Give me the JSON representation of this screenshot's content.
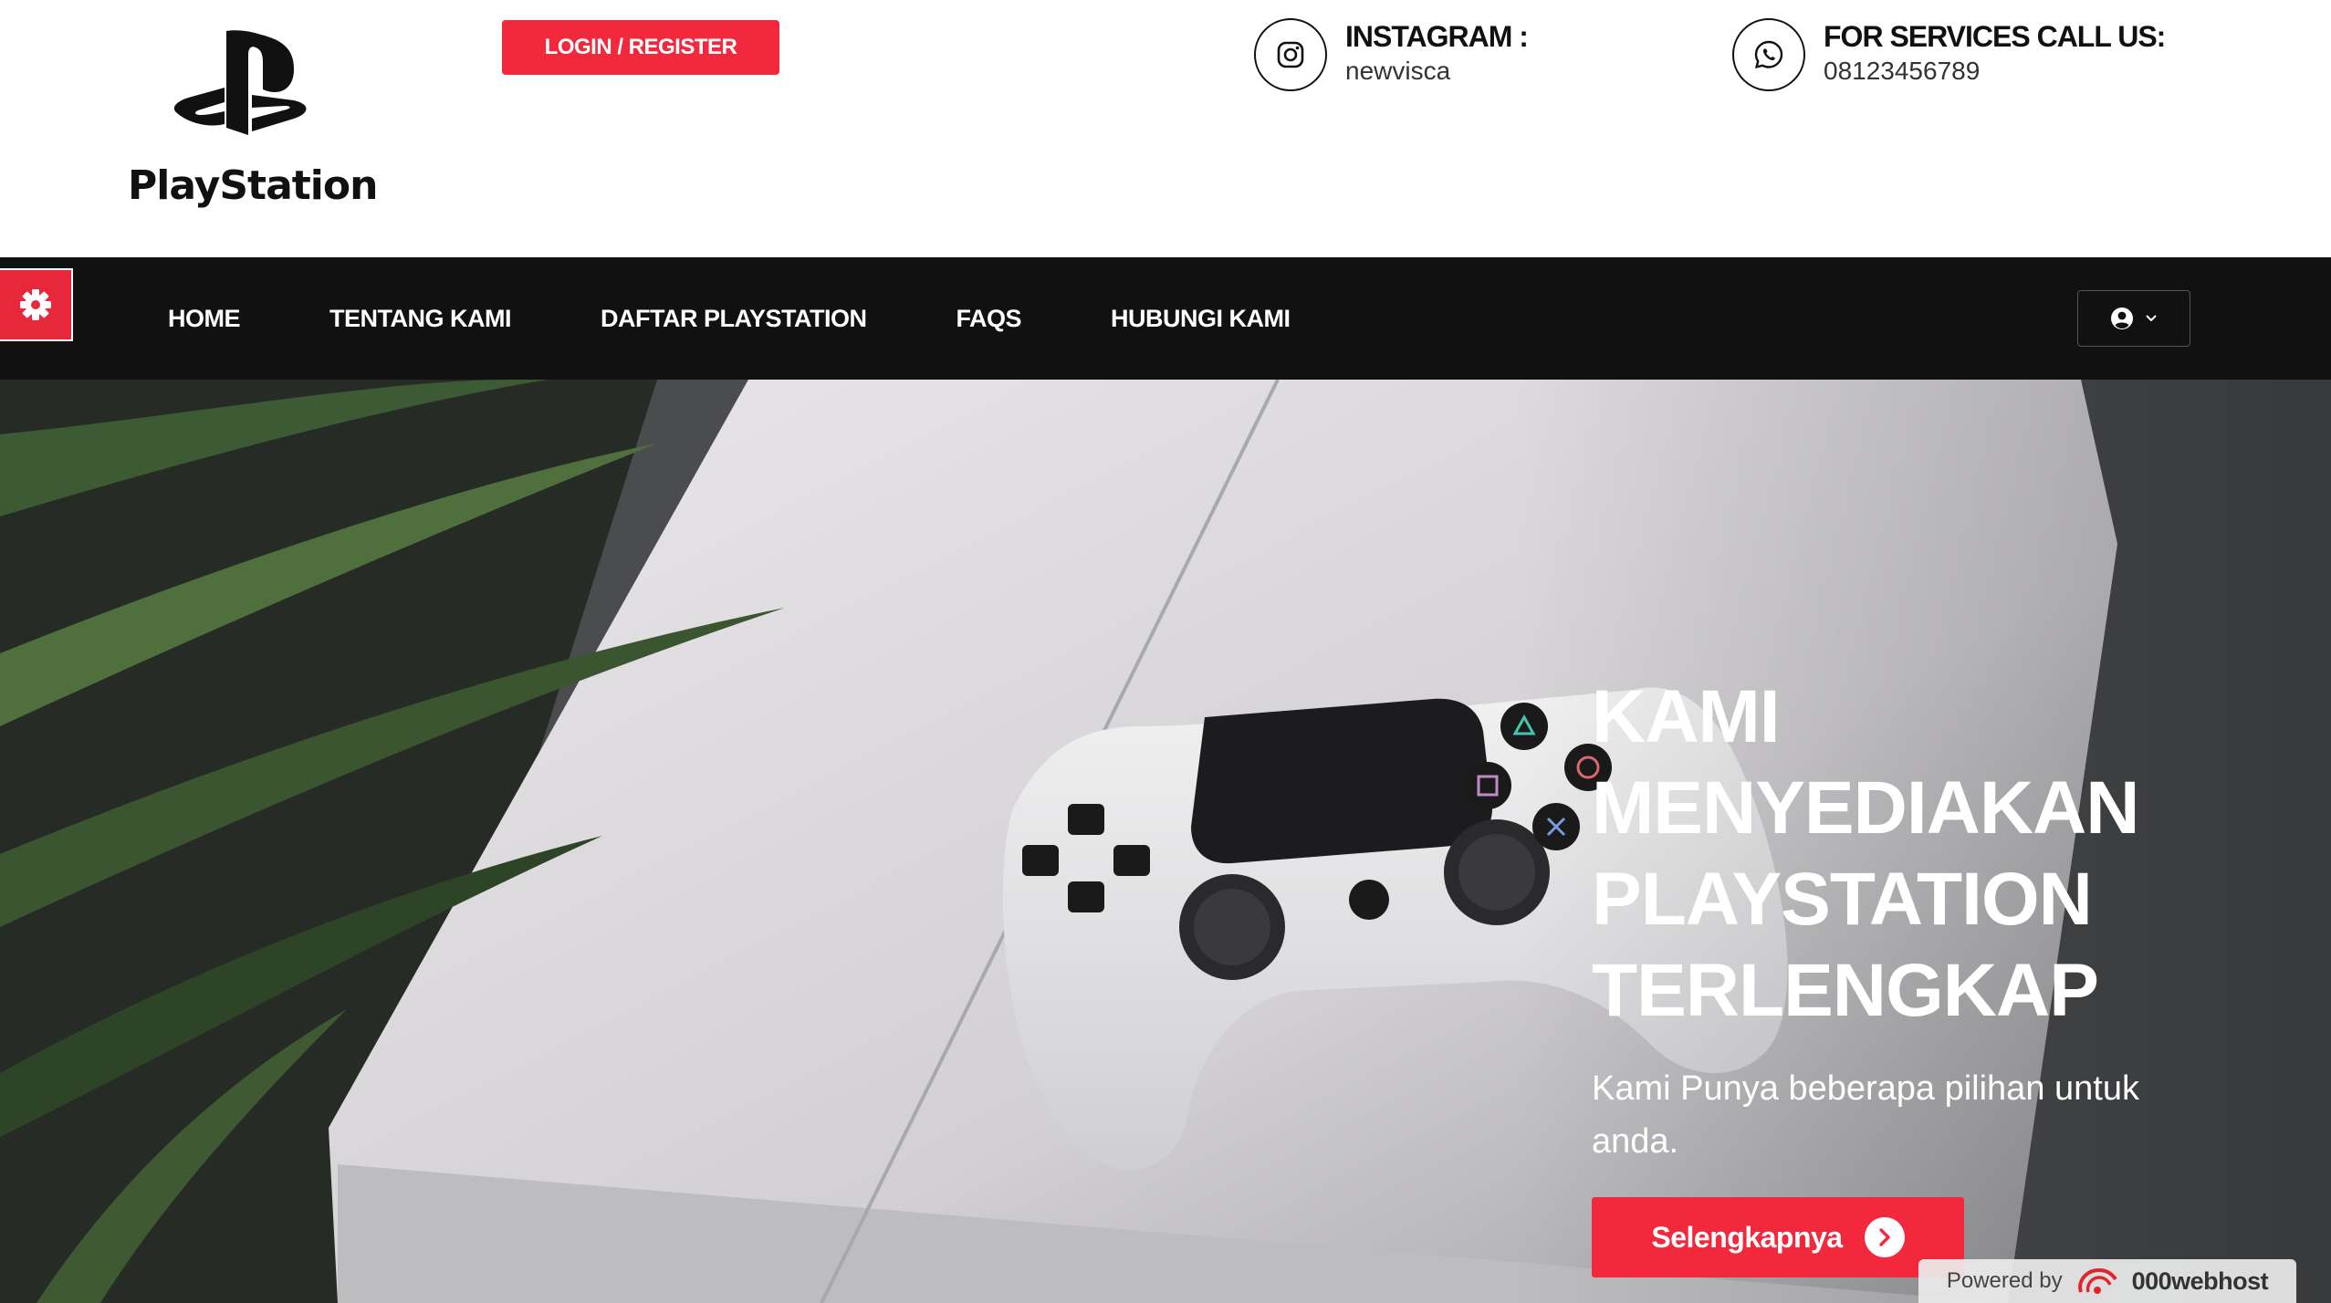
{
  "header": {
    "logo_text": "PlayStation",
    "login_label": "LOGIN / REGISTER",
    "instagram": {
      "label": "INSTAGRAM :",
      "value": "newvisca",
      "icon": "instagram-icon"
    },
    "services": {
      "label": "FOR SERVICES CALL US:",
      "value": "08123456789",
      "icon": "whatsapp-icon"
    }
  },
  "nav": {
    "items": [
      {
        "label": "HOME"
      },
      {
        "label": "TENTANG KAMI"
      },
      {
        "label": "DAFTAR PLAYSTATION"
      },
      {
        "label": "FAQS"
      },
      {
        "label": "HUBUNGI KAMI"
      }
    ],
    "settings_icon": "gear-icon",
    "user_icon": "user-circle-icon",
    "dropdown_icon": "chevron-down-icon"
  },
  "hero": {
    "title_lines": [
      "KAMI",
      "MENYEDIAKAN",
      "PLAYSTATION",
      "TERLENGKAP"
    ],
    "subtitle": "Kami Punya beberapa pilihan untuk anda.",
    "cta_label": "Selengkapnya",
    "cta_icon": "chevron-right-icon"
  },
  "footer_badge": {
    "prefix": "Powered by",
    "brand": "000webhost"
  },
  "colors": {
    "accent": "#f2283c",
    "navbar": "#111111",
    "text_dark": "#111111"
  }
}
